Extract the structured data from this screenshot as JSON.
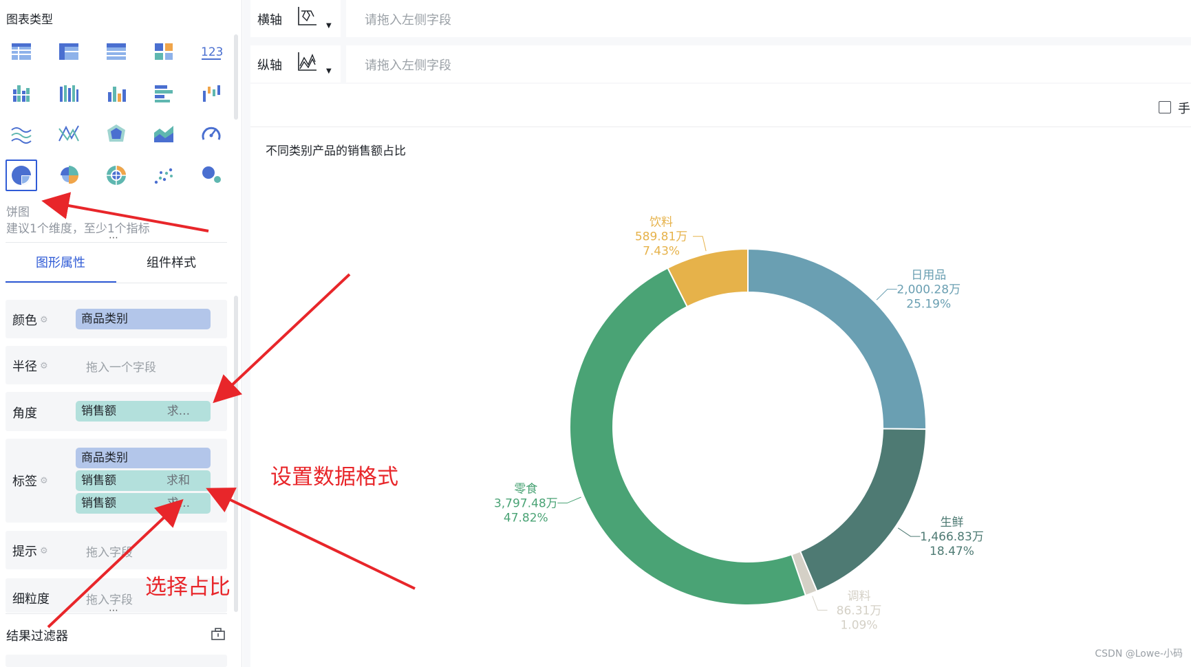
{
  "left_panel": {
    "chart_types_title": "图表类型",
    "chart_types": [
      {
        "name": "table-icon"
      },
      {
        "name": "pivot-table-icon"
      },
      {
        "name": "detail-table-icon"
      },
      {
        "name": "card-icon"
      },
      {
        "name": "number-icon",
        "text": "123"
      },
      {
        "name": "grouped-column-icon"
      },
      {
        "name": "stacked-column-icon"
      },
      {
        "name": "column-icon"
      },
      {
        "name": "bar-icon"
      },
      {
        "name": "waterfall-icon"
      },
      {
        "name": "line-icon"
      },
      {
        "name": "cross-line-icon"
      },
      {
        "name": "radar-icon"
      },
      {
        "name": "area-icon"
      },
      {
        "name": "gauge-icon"
      },
      {
        "name": "pie-icon",
        "selected": true
      },
      {
        "name": "rose-pie-icon"
      },
      {
        "name": "multi-pie-icon"
      },
      {
        "name": "scatter-icon"
      },
      {
        "name": "bubble-icon"
      }
    ],
    "selected_chart_name": "饼图",
    "selected_chart_hint": "建议1个维度，至少1个指标",
    "tabs": [
      {
        "label": "图形属性",
        "active": true
      },
      {
        "label": "组件样式",
        "active": false
      }
    ],
    "properties": {
      "color": {
        "label": "颜色",
        "pill": "商品类别"
      },
      "radius": {
        "label": "半径",
        "placeholder": "拖入一个字段"
      },
      "angle": {
        "label": "角度",
        "pill": "销售额",
        "agg": "求..."
      },
      "labels": {
        "label": "标签",
        "pill1": "商品类别",
        "pill2": "销售额",
        "pill2_agg": "求和",
        "pill3": "销售额",
        "pill3_agg": "求..."
      },
      "tooltip": {
        "label": "提示",
        "placeholder": "拖入字段"
      },
      "granularity": {
        "label": "细粒度",
        "placeholder": "拖入字段"
      }
    },
    "filter_title": "结果过滤器",
    "dots": "⋮"
  },
  "axes": {
    "x": {
      "label": "横轴",
      "placeholder": "请拖入左侧字段"
    },
    "y": {
      "label": "纵轴",
      "placeholder": "请拖入左侧字段"
    }
  },
  "toolbar": {
    "checkbox_label": "手"
  },
  "chart_data": {
    "type": "pie",
    "title": "不同类别产品的销售额占比",
    "donut": true,
    "start_angle_deg": 0,
    "slices": [
      {
        "name": "日用品",
        "value_text": "2,000.28万",
        "percent_text": "25.19%",
        "percent": 25.19,
        "color": "#6a9fb2"
      },
      {
        "name": "生鲜",
        "value_text": "1,466.83万",
        "percent_text": "18.47%",
        "percent": 18.47,
        "color": "#4e7a73"
      },
      {
        "name": "调料",
        "value_text": "86.31万",
        "percent_text": "1.09%",
        "percent": 1.09,
        "color": "#d4d0c6"
      },
      {
        "name": "零食",
        "value_text": "3,797.48万",
        "percent_text": "47.82%",
        "percent": 47.82,
        "color": "#4aa375"
      },
      {
        "name": "饮料",
        "value_text": "589.81万",
        "percent_text": "7.43%",
        "percent": 7.43,
        "color": "#e6b24a"
      }
    ]
  },
  "annotations": {
    "set_format": "设置数据格式",
    "select_ratio": "选择占比",
    "arrow_color": "#e8262a"
  },
  "watermark": "CSDN @Lowe-小码"
}
